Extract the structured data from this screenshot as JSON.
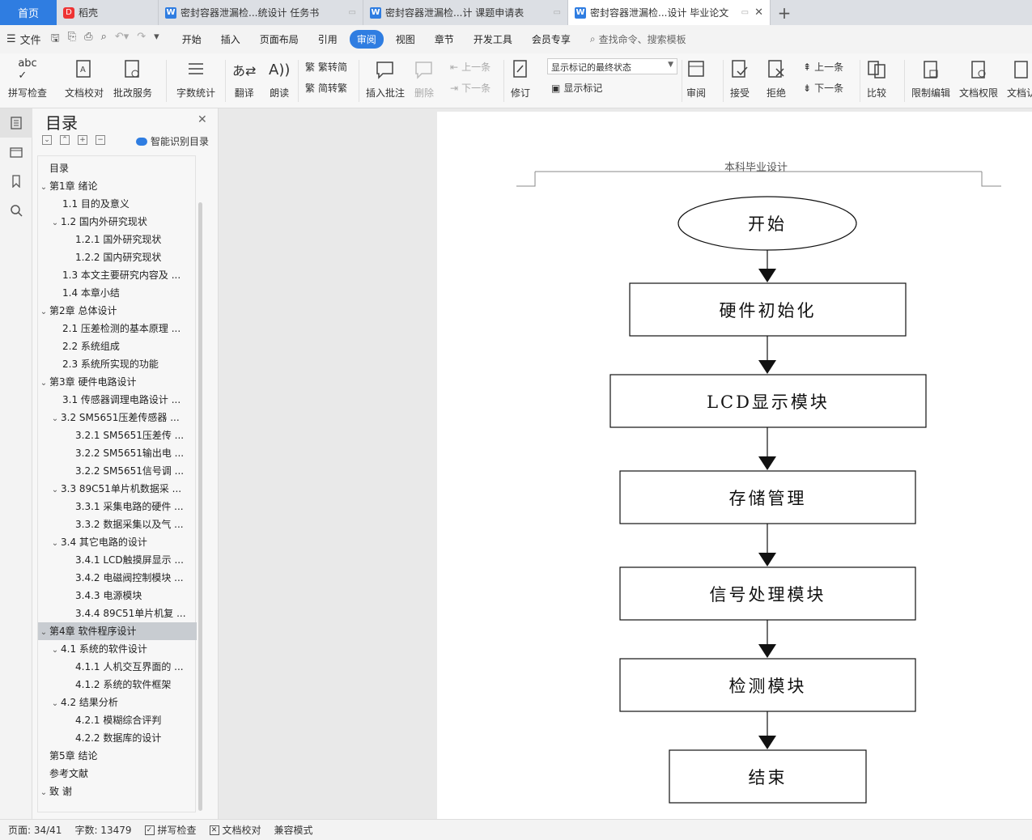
{
  "tabs": {
    "home": "首页",
    "items": [
      {
        "label": "稻壳",
        "icon": "daoke-icon"
      },
      {
        "label": "密封容器泄漏检...统设计 任务书",
        "icon": "word-doc-icon"
      },
      {
        "label": "密封容器泄漏检...计 课题申请表",
        "icon": "word-doc-icon"
      },
      {
        "label": "密封容器泄漏检...设计 毕业论文",
        "icon": "word-doc-icon",
        "active": true
      }
    ]
  },
  "menu": {
    "file": "文件",
    "items": [
      "开始",
      "插入",
      "页面布局",
      "引用",
      "审阅",
      "视图",
      "章节",
      "开发工具",
      "会员专享"
    ],
    "active": "审阅",
    "search": "查找命令、搜索模板"
  },
  "ribbon": {
    "spell": "拼写检查",
    "proof": "文档校对",
    "batch": "批改服务",
    "wordcount": "字数统计",
    "translate": "翻译",
    "read": "朗读",
    "to_trad": "繁转简",
    "to_simp": "简转繁",
    "insert_comment": "插入批注",
    "delete": "删除",
    "prev_comment": "上一条",
    "next_comment": "下一条",
    "track": "修订",
    "markup_state": "显示标记的最终状态",
    "show_markup": "显示标记",
    "review": "审阅",
    "accept": "接受",
    "reject": "拒绝",
    "prev_change": "上一条",
    "next_change": "下一条",
    "compare": "比较",
    "restrict": "限制编辑",
    "permission": "文档权限",
    "doc_more": "文档认"
  },
  "toc": {
    "title": "目录",
    "smart": "智能识别目录",
    "items": [
      {
        "label": "目录",
        "level": 0,
        "chev": ""
      },
      {
        "label": "第1章  绪论",
        "level": 0,
        "chev": "v"
      },
      {
        "label": "1.1  目的及意义",
        "level": 1,
        "chev": ""
      },
      {
        "label": "1.2  国内外研究现状",
        "level": 1,
        "chev": "v"
      },
      {
        "label": "1.2.1  国外研究现状",
        "level": 2,
        "chev": ""
      },
      {
        "label": "1.2.2  国内研究现状",
        "level": 2,
        "chev": ""
      },
      {
        "label": "1.3  本文主要研究内容及 ...",
        "level": 1,
        "chev": ""
      },
      {
        "label": "1.4  本章小结",
        "level": 1,
        "chev": ""
      },
      {
        "label": "第2章  总体设计",
        "level": 0,
        "chev": "v"
      },
      {
        "label": "2.1  压差检测的基本原理 ...",
        "level": 1,
        "chev": ""
      },
      {
        "label": "2.2  系统组成",
        "level": 1,
        "chev": ""
      },
      {
        "label": "2.3  系统所实现的功能",
        "level": 1,
        "chev": ""
      },
      {
        "label": "第3章  硬件电路设计",
        "level": 0,
        "chev": "v"
      },
      {
        "label": "3.1  传感器调理电路设计 ...",
        "level": 1,
        "chev": ""
      },
      {
        "label": "3.2 SM5651压差传感器 ...",
        "level": 1,
        "chev": "v"
      },
      {
        "label": "3.2.1 SM5651压差传 ...",
        "level": 2,
        "chev": ""
      },
      {
        "label": "3.2.2 SM5651输出电 ...",
        "level": 2,
        "chev": ""
      },
      {
        "label": "3.2.2 SM5651信号调 ...",
        "level": 2,
        "chev": ""
      },
      {
        "label": "3.3 89C51单片机数据采 ...",
        "level": 1,
        "chev": "v"
      },
      {
        "label": "3.3.1  采集电路的硬件 ...",
        "level": 2,
        "chev": ""
      },
      {
        "label": "3.3.2  数据采集以及气 ...",
        "level": 2,
        "chev": ""
      },
      {
        "label": "3.4  其它电路的设计",
        "level": 1,
        "chev": "v"
      },
      {
        "label": "3.4.1 LCD触摸屏显示 ...",
        "level": 2,
        "chev": ""
      },
      {
        "label": "3.4.2  电磁阀控制模块 ...",
        "level": 2,
        "chev": ""
      },
      {
        "label": "3.4.3  电源模块",
        "level": 2,
        "chev": ""
      },
      {
        "label": "3.4.4 89C51单片机复 ...",
        "level": 2,
        "chev": ""
      },
      {
        "label": "第4章  软件程序设计",
        "level": 0,
        "chev": "v",
        "selected": true
      },
      {
        "label": "4.1  系统的软件设计",
        "level": 1,
        "chev": "v"
      },
      {
        "label": "4.1.1  人机交互界面的 ...",
        "level": 2,
        "chev": ""
      },
      {
        "label": "4.1.2  系统的软件框架",
        "level": 2,
        "chev": ""
      },
      {
        "label": "4.2  结果分析",
        "level": 1,
        "chev": "v"
      },
      {
        "label": "4.2.1  模糊综合评判",
        "level": 2,
        "chev": ""
      },
      {
        "label": "4.2.2  数据库的设计",
        "level": 2,
        "chev": ""
      },
      {
        "label": "第5章  结论",
        "level": 0,
        "chev": ""
      },
      {
        "label": "参考文献",
        "level": 0,
        "chev": ""
      },
      {
        "label": "致    谢",
        "level": 0,
        "chev": "v"
      }
    ]
  },
  "document": {
    "header": "本科毕业设计",
    "flow": {
      "start": "开始",
      "steps": [
        "硬件初始化",
        "LCD显示模块",
        "存储管理",
        "信号处理模块",
        "检测模块"
      ],
      "end": "结束"
    }
  },
  "status": {
    "page": "页面: 34/41",
    "words": "字数: 13479",
    "spell": "拼写检查",
    "proof": "文档校对",
    "compat": "兼容模式"
  }
}
